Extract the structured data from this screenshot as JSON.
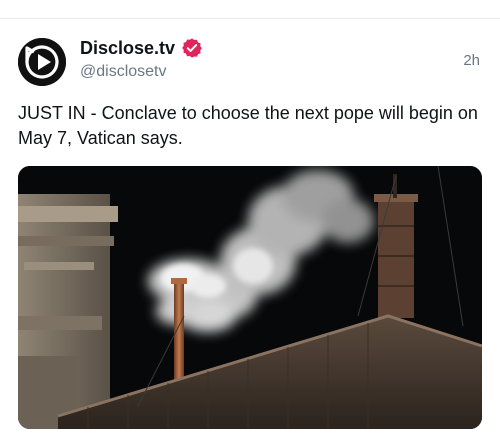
{
  "post": {
    "author": {
      "name": "Disclose.tv",
      "handle": "@disclosetv",
      "verified": true,
      "avatar_icon": "play-button-logo-icon",
      "badge_icon": "verified-badge-icon",
      "badge_color": "#e0245e"
    },
    "timestamp": "2h",
    "text": "JUST IN - Conclave to choose the next pope will begin on May 7, Vatican says.",
    "media": {
      "type": "photo",
      "subject_icon": "chimney-smoke-photo"
    }
  }
}
